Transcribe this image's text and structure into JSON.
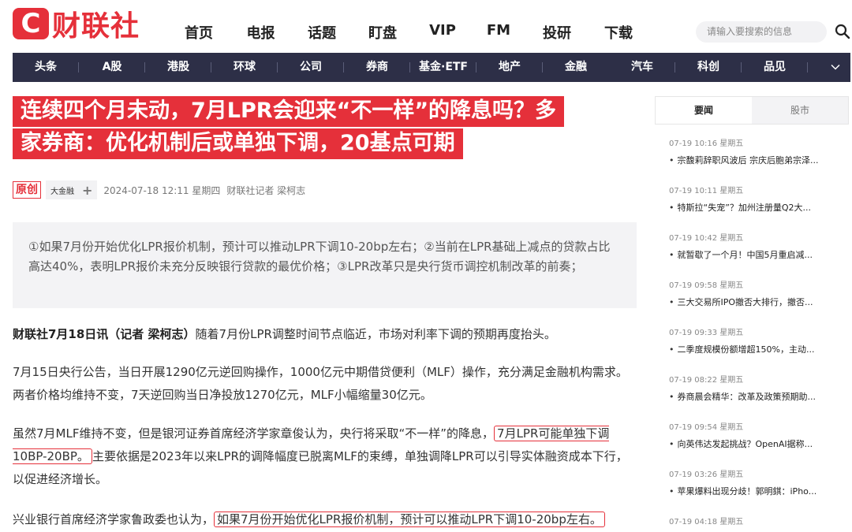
{
  "header": {
    "logo_letter": "C",
    "logo_text": "财联社",
    "nav": [
      "首页",
      "电报",
      "话题",
      "盯盘",
      "VIP",
      "FM",
      "投研",
      "下载"
    ],
    "search_placeholder": "请输入要搜索的信息"
  },
  "channels": [
    "头条",
    "A股",
    "港股",
    "环球",
    "公司",
    "券商",
    "基金·ETF",
    "地产",
    "金融",
    "汽车",
    "科创",
    "品见"
  ],
  "article": {
    "title_lines": [
      "连续四个月未动，7月LPR会迎来“不一样”的降息吗？多",
      "家券商：优化机制后或单独下调，20基点可期"
    ],
    "badge_original": "原创",
    "tag": "大金融",
    "tag_plus": "+",
    "date": "2024-07-18 12:11 星期四",
    "author": "财联社记者 梁柯志",
    "summary": "①如果7月份开始优化LPR报价机制，预计可以推动LPR下调10-20bp左右；②当前在LPR基础上减点的贷款占比高达40%，表明LPR报价未充分反映银行贷款的最优价格；③LPR改革只是央行货币调控机制改革的前奏；",
    "p1_lead": "财联社7月18日讯（记者 梁柯志）",
    "p1_rest": "随着7月份LPR调整时间节点临近，市场对利率下调的预期再度抬头。",
    "p2": "7月15日央行公告，当日开展1290亿元逆回购操作，1000亿元中期借贷便利（MLF）操作，充分满足金融机构需求。两者价格均维持不变，7天逆回购当日净投放1270亿元，MLF小幅缩量30亿元。",
    "p3_a": "虽然7月MLF维持不变，但是银河证券首席经济学家章俊认为，央行将采取“不一样”的降息，",
    "p3_hl": "7月LPR可能单独下调10BP-20BP。",
    "p3_b": "主要依据是2023年以来LPR的调降幅度已脱离MLF的束缚，单独调降LPR可以引导实体融资成本下行，以促进经济增长。",
    "p4_a": "兴业银行首席经济学家鲁政委也认为，",
    "p4_hl": "如果7月份开始优化LPR报价机制，预计可以推动LPR下调10-20bp左右。"
  },
  "sidebar": {
    "tabs": [
      "要闻",
      "股市"
    ],
    "news": [
      {
        "time": "07-19 10:16 星期五",
        "title": "宗馥莉辞职风波后 宗庆后胞弟宗泽..."
      },
      {
        "time": "07-19 10:11 星期五",
        "title": "特斯拉“失宠”？加州注册量Q2大..."
      },
      {
        "time": "07-19 10:42 星期五",
        "title": "就暂歇了一个月！中国5月重启减..."
      },
      {
        "time": "07-19 09:58 星期五",
        "title": "三大交易所IPO撤否大排行，撤否..."
      },
      {
        "time": "07-19 09:33 星期五",
        "title": "二季度规模份额增超150%，主动..."
      },
      {
        "time": "07-19 08:22 星期五",
        "title": "券商晨会精华：改革及政策预期助..."
      },
      {
        "time": "07-19 09:54 星期五",
        "title": "向英伟达发起挑战？OpenAI据称..."
      },
      {
        "time": "07-19 03:26 星期五",
        "title": "苹果爆料出现分歧！郭明錤：iPho..."
      },
      {
        "time": "07-19 04:18 星期五",
        "title": ""
      }
    ]
  },
  "colors": {
    "brand_red": "#e5303a",
    "nav_bar": "#2d2f47"
  }
}
